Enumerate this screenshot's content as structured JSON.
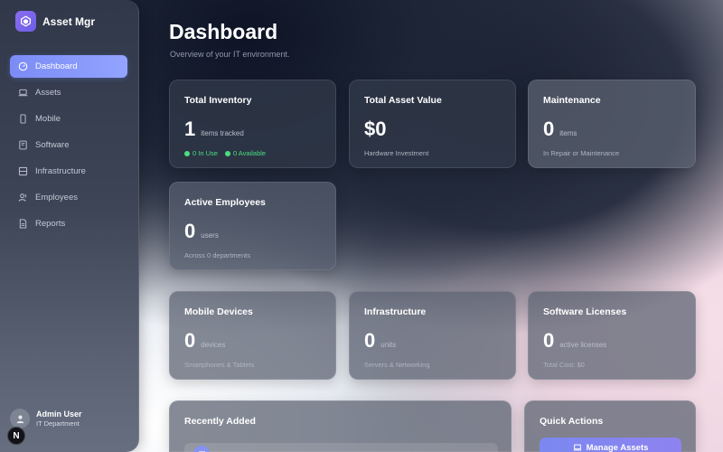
{
  "brand": {
    "name": "Asset Mgr"
  },
  "sidebar": {
    "items": [
      {
        "label": "Dashboard",
        "icon": "dashboard-icon",
        "active": true
      },
      {
        "label": "Assets",
        "icon": "laptop-icon"
      },
      {
        "label": "Mobile",
        "icon": "mobile-icon"
      },
      {
        "label": "Software",
        "icon": "software-icon"
      },
      {
        "label": "Infrastructure",
        "icon": "server-icon"
      },
      {
        "label": "Employees",
        "icon": "users-icon"
      },
      {
        "label": "Reports",
        "icon": "document-icon"
      }
    ]
  },
  "user": {
    "name": "Admin User",
    "department": "IT Department",
    "badge": "N"
  },
  "header": {
    "title": "Dashboard",
    "subtitle": "Overview of your IT environment."
  },
  "cards": {
    "total_inventory": {
      "title": "Total Inventory",
      "value": "1",
      "unit": "items tracked",
      "in_use": "0 In Use",
      "available": "0 Available"
    },
    "total_asset_value": {
      "title": "Total Asset Value",
      "value": "$0",
      "desc": "Hardware Investment"
    },
    "maintenance": {
      "title": "Maintenance",
      "value": "0",
      "unit": "items",
      "desc": "In Repair or Maintenance"
    },
    "active_employees": {
      "title": "Active Employees",
      "value": "0",
      "unit": "users",
      "desc": "Across 0 departments"
    },
    "mobile_devices": {
      "title": "Mobile Devices",
      "value": "0",
      "unit": "devices",
      "desc": "Smartphones & Tablets"
    },
    "infrastructure": {
      "title": "Infrastructure",
      "value": "0",
      "unit": "units",
      "desc": "Servers & Networking"
    },
    "software_licenses": {
      "title": "Software Licenses",
      "value": "0",
      "unit": "active licenses",
      "desc": "Total Cost: $0"
    }
  },
  "recent": {
    "title": "Recently Added"
  },
  "quick_actions": {
    "title": "Quick Actions",
    "manage_assets_label": "Manage Assets"
  },
  "colors": {
    "accent": "#7b8cf5",
    "success": "#4ade80"
  }
}
